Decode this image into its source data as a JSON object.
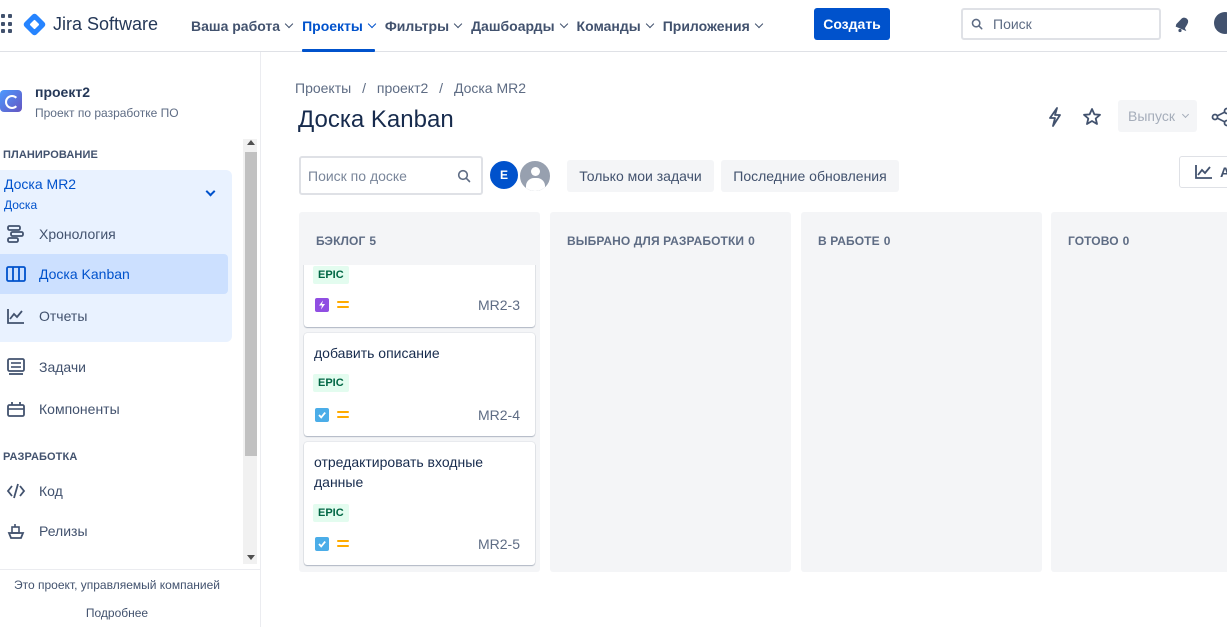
{
  "topnav": {
    "logo_text": "Jira Software",
    "items": [
      {
        "label": "Ваша работа",
        "active": false
      },
      {
        "label": "Проекты",
        "active": true
      },
      {
        "label": "Фильтры",
        "active": false
      },
      {
        "label": "Дашбоарды",
        "active": false
      },
      {
        "label": "Команды",
        "active": false
      },
      {
        "label": "Приложения",
        "active": false
      }
    ],
    "create_label": "Создать",
    "search_placeholder": "Поиск"
  },
  "sidebar": {
    "project_name": "проект2",
    "project_subtitle": "Проект по разработке ПО",
    "planning_title": "ПЛАНИРОВАНИЕ",
    "board_group_title": "Доска MR2",
    "board_group_subtitle": "Доска",
    "planning_items": [
      {
        "label": "Хронология",
        "icon": "timeline-icon"
      },
      {
        "label": "Доска Kanban",
        "icon": "board-icon",
        "active": true
      },
      {
        "label": "Отчеты",
        "icon": "reports-icon"
      }
    ],
    "other_items": [
      {
        "label": "Задачи",
        "icon": "issues-icon"
      },
      {
        "label": "Компоненты",
        "icon": "components-icon"
      }
    ],
    "development_title": "РАЗРАБОТКА",
    "development_items": [
      {
        "label": "Код",
        "icon": "code-icon"
      },
      {
        "label": "Релизы",
        "icon": "releases-icon"
      }
    ],
    "footer_text": "Это проект, управляемый компанией",
    "footer_link": "Подробнее"
  },
  "main": {
    "breadcrumb": [
      "Проекты",
      "/",
      "проект2",
      "/",
      "Доска MR2"
    ],
    "title": "Доска Kanban",
    "release_label": "Выпуск",
    "board_search_placeholder": "Поиск по доске",
    "avatar_initial": "E",
    "filters": [
      "Только мои задачи",
      "Последние обновления"
    ],
    "insights_label": "A",
    "columns": [
      {
        "title": "БЭКЛОГ",
        "count": "5"
      },
      {
        "title": "ВЫБРАНО ДЛЯ РАЗРАБОТКИ",
        "count": "0"
      },
      {
        "title": "В РАБОТЕ",
        "count": "0"
      },
      {
        "title": "ГОТОВО",
        "count": "0"
      }
    ],
    "cards": [
      {
        "summary": "",
        "label": "EPIC",
        "type": "epic",
        "key": "MR2-3"
      },
      {
        "summary": "добавить описание",
        "label": "EPIC",
        "type": "task",
        "key": "MR2-4"
      },
      {
        "summary": "отредактировать входные данные",
        "label": "EPIC",
        "type": "task",
        "key": "MR2-5"
      }
    ]
  },
  "colors": {
    "accent": "#0052cc",
    "epic_type": "#904ee2",
    "task_type": "#4bade8",
    "priority_medium": "#ffab00",
    "label_bg": "#e3fcef",
    "label_text": "#006644"
  }
}
